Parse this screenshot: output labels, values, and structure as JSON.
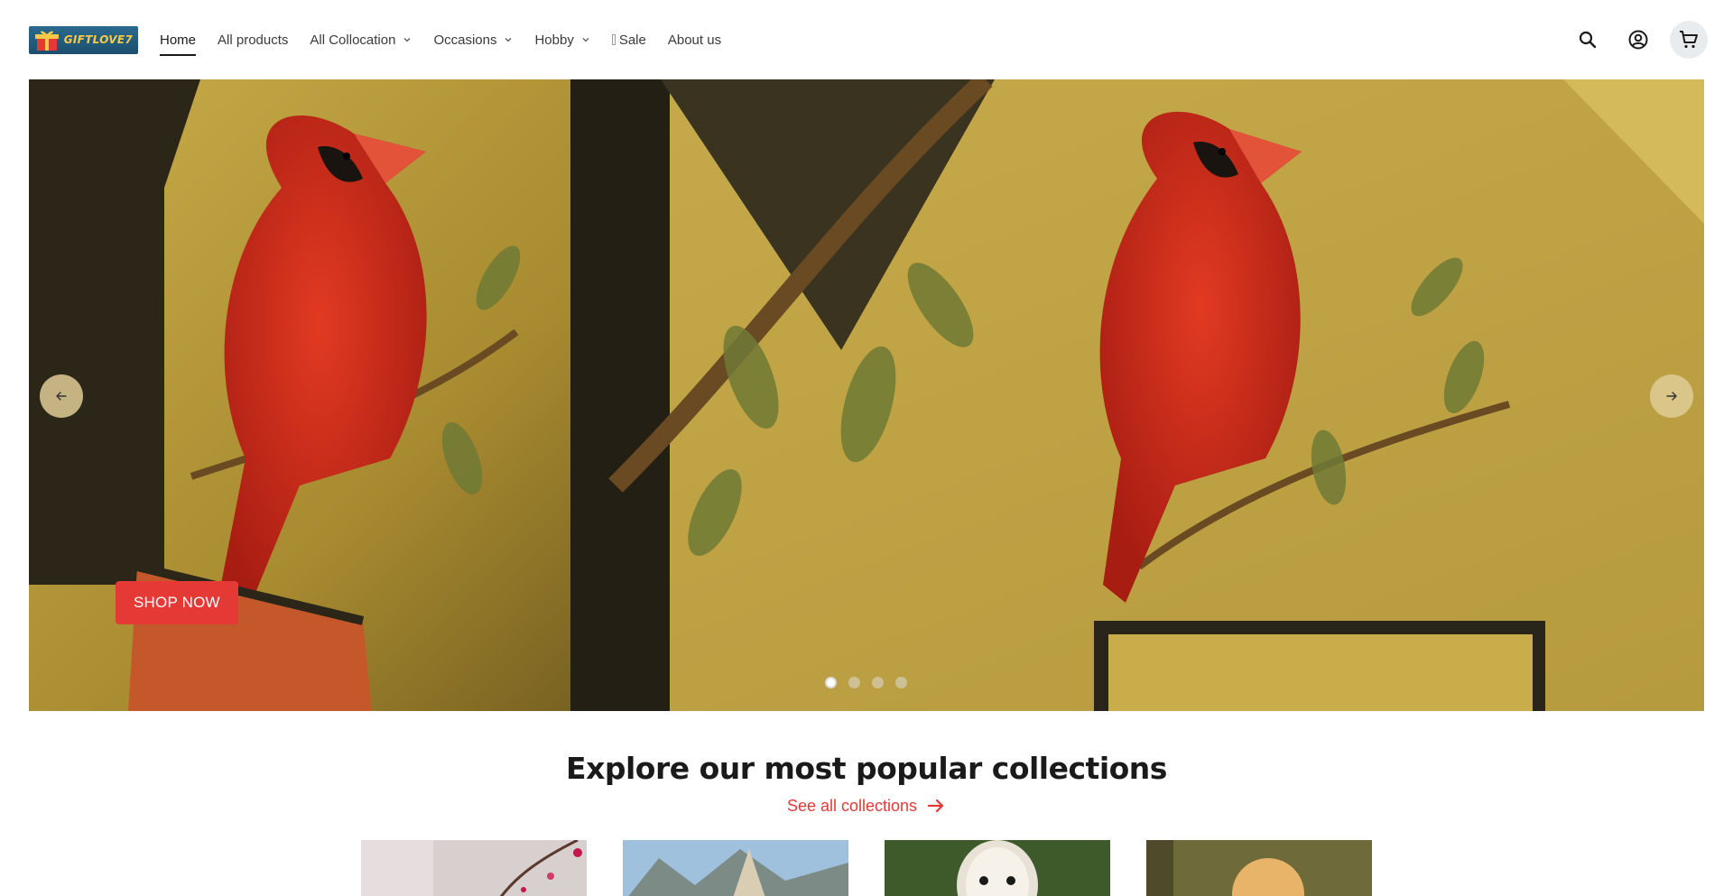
{
  "header": {
    "logo_text": "GIFTLOVE7",
    "nav": [
      {
        "label": "Home",
        "has_dropdown": false,
        "active": true
      },
      {
        "label": "All products",
        "has_dropdown": false
      },
      {
        "label": "All Collocation",
        "has_dropdown": true
      },
      {
        "label": "Occasions",
        "has_dropdown": true
      },
      {
        "label": "Hobby",
        "has_dropdown": true
      },
      {
        "label": "Sale",
        "has_dropdown": false
      },
      {
        "label": "About us",
        "has_dropdown": false
      }
    ],
    "icons": [
      "search-icon",
      "account-icon",
      "cart-icon"
    ]
  },
  "hero": {
    "button_label": "SHOP NOW",
    "slide_count": 4,
    "active_slide": 1,
    "image_subject": "red-cardinal-jacket"
  },
  "collections": {
    "title": "Explore our most popular collections",
    "see_all_label": "See all collections",
    "cards": [
      "pink-blossom-collection",
      "native-tipi-collection",
      "barn-owl-collection",
      "golden-chick-collection"
    ]
  },
  "colors": {
    "accent": "#e53935",
    "hero_bg": "#b59a3c",
    "text": "#1a1a1a"
  }
}
